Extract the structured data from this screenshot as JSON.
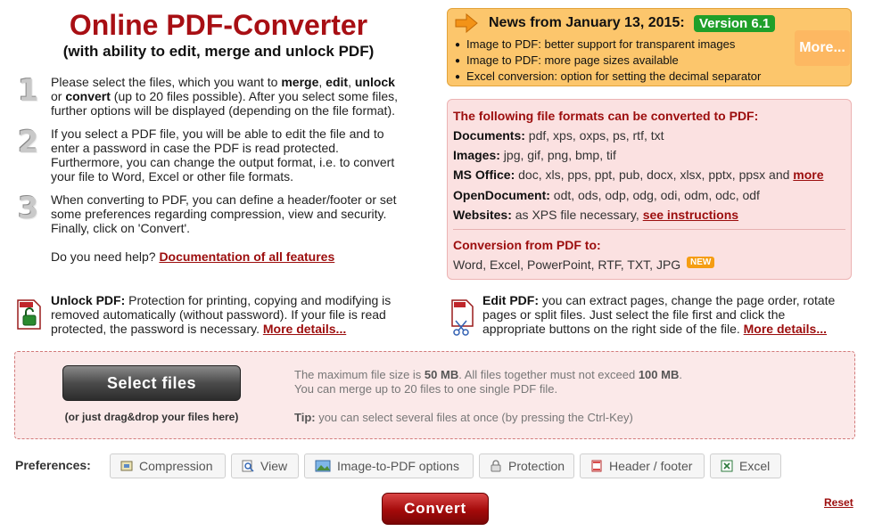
{
  "header": {
    "title": "Online PDF-Converter",
    "subtitle": "(with ability to edit, merge and unlock PDF)"
  },
  "steps": [
    {
      "number": "1",
      "line1_prefix": "Please select the files, which you want to ",
      "merge": "merge",
      "sep1": ", ",
      "edit": "edit",
      "sep2": ", ",
      "unlock": "unlock",
      "line2_prefix": "or ",
      "convert": "convert",
      "line2_rest": " (up to 20 files possible). After you select some files,",
      "line3": "further options will be displayed (depending on the file format)."
    },
    {
      "number": "2",
      "lines": [
        "If you select a PDF file, you will be able to edit the file and to",
        "enter a password in case the PDF is read protected.",
        "Furthermore, you can change the output format, i.e. to convert",
        "your file to Word, Excel or other file formats."
      ]
    },
    {
      "number": "3",
      "lines": [
        "When converting to PDF, you can define a header/footer or set",
        "some preferences regarding compression, view and security.",
        "Finally, click on 'Convert'."
      ]
    }
  ],
  "help": {
    "text": "Do you need help? ",
    "link": "Documentation of all features"
  },
  "news": {
    "title": "News from January 13, 2015:",
    "version": "Version 6.1",
    "items": [
      "Image to PDF: better support for transparent images",
      "Image to PDF: more page sizes available",
      "Excel conversion: option for setting the decimal separator"
    ],
    "more": "More..."
  },
  "formats": {
    "heading_a": "The following file formats can be converted ",
    "heading_b": "to PDF:",
    "documents_label": "Documents:",
    "documents": " pdf, xps, oxps, ps, rtf, txt",
    "images_label": "Images:",
    "images": " jpg, gif, png, bmp, tif",
    "msoffice_label": "MS Office:",
    "msoffice": " doc, xls, pps, ppt, pub, docx, xlsx, pptx, ppsx and ",
    "msoffice_link": "more",
    "opendoc_label": "OpenDocument:",
    "opendoc": " odt, ods, odp, odg, odi, odm, odc, odf",
    "websites_label": "Websites:",
    "websites": " as XPS file necessary, ",
    "websites_link": "see instructions",
    "conv_heading_a": "Conversion ",
    "conv_heading_b": "from PDF to:",
    "conv_list": "Word, Excel, PowerPoint, RTF, TXT, JPG",
    "new_badge": "NEW"
  },
  "unlock": {
    "label": "Unlock PDF:",
    "line1": " Protection for printing, copying and modifying is",
    "line2": "removed automatically (without password). If your file is read",
    "line3": "protected, the password is necessary. ",
    "link": "More details..."
  },
  "edit": {
    "label": "Edit PDF:",
    "line1": " you can extract pages, change the page order, rotate",
    "line2": "pages or split files. Just select the file first and click the",
    "line3": "appropriate buttons on the right side of the file. ",
    "link": "More details..."
  },
  "dropzone": {
    "select_button": "Select files",
    "dragdrop": "(or just drag&drop your files here)",
    "limit_a": "The maximum file size is ",
    "limit_max": "50 MB",
    "limit_b": ". All files together must not exceed ",
    "limit_total": "100 MB",
    "limit_c": ".",
    "limit_line2": "You can merge up to 20 files to one single PDF file.",
    "tip_label": "Tip:",
    "tip": " you can select several files at once (by pressing the Ctrl-Key)"
  },
  "preferences": {
    "label": "Preferences:",
    "buttons": [
      "Compression",
      "View",
      "Image-to-PDF options",
      "Protection",
      "Header / footer",
      "Excel"
    ]
  },
  "actions": {
    "convert": "Convert",
    "reset": "Reset"
  }
}
